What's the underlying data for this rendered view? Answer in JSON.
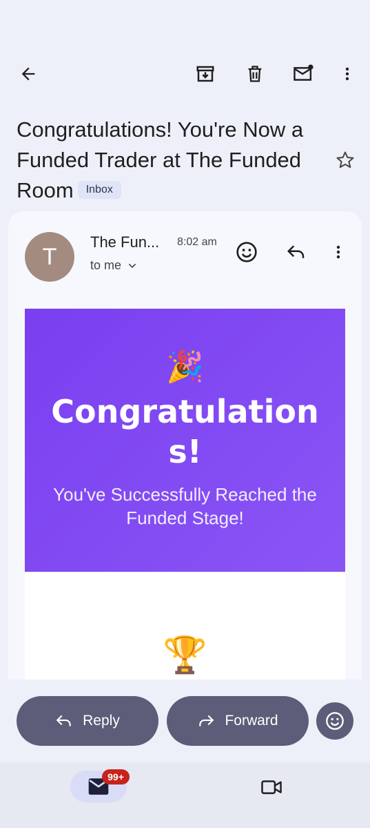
{
  "toolbar": {
    "back": "arrow-back-icon",
    "archive": "archive-icon",
    "delete": "trash-icon",
    "mark_unread": "mark-unread-icon",
    "more": "more-vert-icon"
  },
  "subject": {
    "text": "Congratulations! You're Now a Funded Trader at The Funded Room",
    "label": "Inbox"
  },
  "message": {
    "avatar_letter": "T",
    "avatar_color": "#a38b80",
    "sender": "The Fun...",
    "time": "8:02 am",
    "recipient": "to me"
  },
  "email_body": {
    "banner_emoji": "🎉",
    "headline": "Congratulations!",
    "subheadline": "You've Successfully Reached the Funded Stage!",
    "trophy_emoji": "🏆",
    "banner_color": "#7a3ff0"
  },
  "actions": {
    "reply_label": "Reply",
    "forward_label": "Forward"
  },
  "nav": {
    "mail_badge": "99+"
  }
}
